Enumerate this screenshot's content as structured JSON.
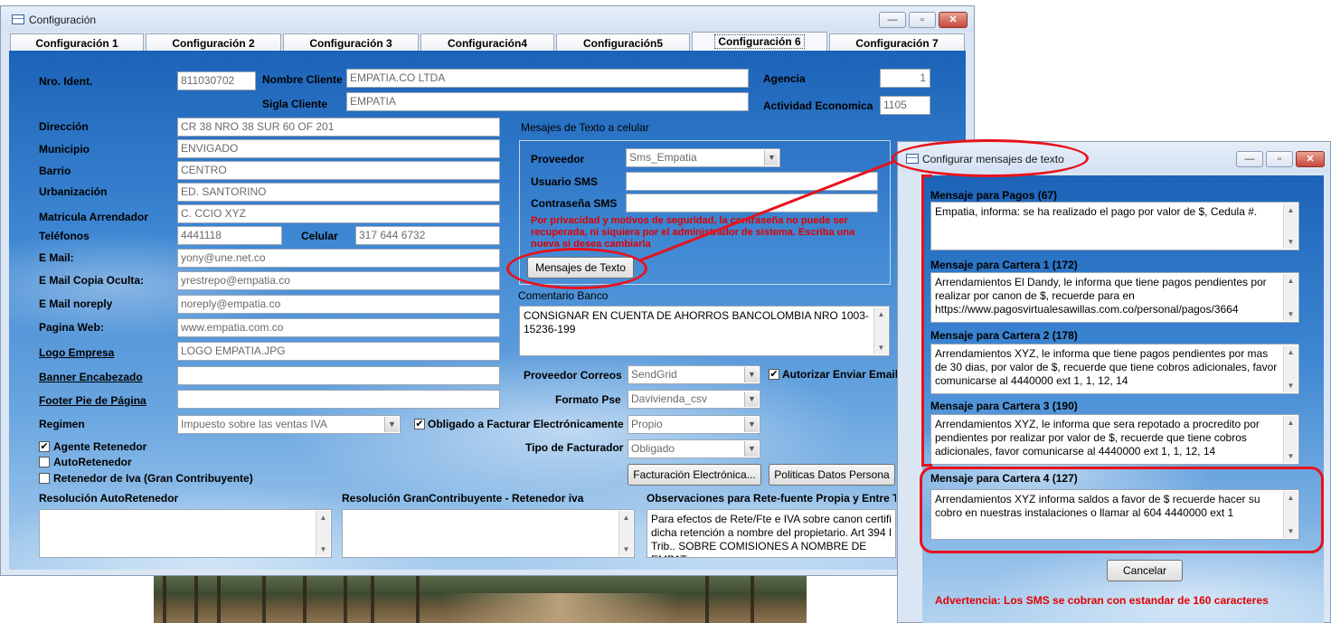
{
  "main_window": {
    "title": "Configuración",
    "tabs": [
      "Configuración 1",
      "Configuración 2",
      "Configuración 3",
      "Configuración4",
      "Configuración5",
      "Configuración 6",
      "Configuración 7"
    ],
    "active_tab": "Configuración 6"
  },
  "form": {
    "nro_ident": {
      "label": "Nro. Ident.",
      "value": "811030702"
    },
    "nombre_cliente": {
      "label": "Nombre Cliente",
      "value": "EMPATIA.CO LTDA"
    },
    "sigla_cliente": {
      "label": "Sigla Cliente",
      "value": "EMPATIA"
    },
    "agencia": {
      "label": "Agencia",
      "value": "1"
    },
    "actividad": {
      "label": "Actividad Economica",
      "value": "1105"
    },
    "direccion": {
      "label": "Dirección",
      "value": "CR 38 NRO 38 SUR 60 OF 201"
    },
    "municipio": {
      "label": "Municipio",
      "value": "ENVIGADO"
    },
    "barrio": {
      "label": "Barrio",
      "value": "CENTRO"
    },
    "urbanizacion": {
      "label": "Urbanización",
      "value": "ED. SANTORINO"
    },
    "matricula": {
      "label": "Matricula Arrendador",
      "value": "C. CCIO XYZ"
    },
    "telefonos": {
      "label": "Teléfonos",
      "value": "4441118"
    },
    "celular": {
      "label": "Celular",
      "value": "317 644 6732"
    },
    "email": {
      "label": "E Mail:",
      "value": "yony@une.net.co"
    },
    "email_oculta": {
      "label": "E Mail Copia Oculta:",
      "value": "yrestrepo@empatia.co"
    },
    "email_noreply": {
      "label": "E Mail noreply",
      "value": "noreply@empatia.co"
    },
    "pagina_web": {
      "label": "Pagina Web:",
      "value": "www.empatia.com.co"
    },
    "logo": {
      "label": "Logo Empresa",
      "value": "LOGO EMPATIA.JPG"
    },
    "banner": {
      "label": "Banner Encabezado",
      "value": ""
    },
    "footer": {
      "label": "Footer Pie de Página",
      "value": ""
    },
    "regimen": {
      "label": "Regimen",
      "value": "Impuesto sobre las ventas IVA"
    },
    "obligado_facturar": {
      "label": "Obligado a Facturar Electrónicamente",
      "checked": true,
      "value": "Propio"
    },
    "tipo_facturador": {
      "label": "Tipo de Facturador",
      "value": "Obligado"
    },
    "agente_retenedor": {
      "label": "Agente Retenedor",
      "checked": true
    },
    "autoretenedor": {
      "label": "AutoRetenedor",
      "checked": false
    },
    "retenedor_iva": {
      "label": "Retenedor de Iva (Gran Contribuyente)",
      "checked": false
    },
    "resolucion_auto": {
      "label": "Resolución AutoRetenedor",
      "value": ""
    },
    "resolucion_gran": {
      "label": "Resolución GranContribuyente  - Retenedor iva",
      "value": ""
    },
    "observaciones": {
      "label": "Observaciones para Rete-fuente Propia y Entre Te",
      "value": "Para efectos de Rete/Fte e IVA sobre canon certifi dicha retención a nombre del propietario. Art 394 I Trib.. SOBRE COMISIONES A NOMBRE DE EMPAT"
    }
  },
  "sms": {
    "section_title": "Mesajes de Texto a celular",
    "proveedor": {
      "label": "Proveedor",
      "value": "Sms_Empatia"
    },
    "usuario": {
      "label": "Usuario SMS",
      "value": ""
    },
    "contrasena": {
      "label": "Contraseña SMS",
      "value": ""
    },
    "warning": "Por privacidad y motivos de seguridad, la contraseña no puede ser recuperada, ni siquiera por el administrador de sistema. Escriba una nueva si desea cambiarla",
    "button": "Mensajes de Texto"
  },
  "comentario": {
    "label": "Comentario Banco",
    "value": "CONSIGNAR EN CUENTA DE AHORROS BANCOLOMBIA NRO 1003-15236-199"
  },
  "correos": {
    "label": "Proveedor Correos",
    "value": "SendGrid",
    "autorizar_label": "Autorizar Enviar Email",
    "autorizar_checked": true
  },
  "formato_pse": {
    "label": "Formato Pse",
    "value": "Davivienda_csv"
  },
  "buttons": {
    "facturacion": "Facturación Electrónica...",
    "politicas": "Politicas Datos Persona"
  },
  "dialog": {
    "title": "Configurar mensajes de texto",
    "messages": [
      {
        "label": "Mensaje para Pagos (67)",
        "text": "Empatia, informa: se ha realizado el pago por valor de $, Cedula #."
      },
      {
        "label": "Mensaje para Cartera 1 (172)",
        "text": "Arrendamientos El Dandy, le informa que tiene pagos pendientes por realizar por canon de $, recuerde para en https://www.pagosvirtualesawillas.com.co/personal/pagos/3664"
      },
      {
        "label": "Mensaje para Cartera 2 (178)",
        "text": "Arrendamientos XYZ, le informa que tiene pagos pendientes por mas de 30 dias, por valor de $, recuerde que tiene cobros adicionales, favor comunicarse al 4440000 ext 1, 1, 12, 14"
      },
      {
        "label": "Mensaje para Cartera 3 (190)",
        "text": "Arrendamientos XYZ, le informa que sera repotado a procredito por pendientes por realizar por valor de $, recuerde que tiene cobros adicionales, favor comunicarse al 4440000 ext 1, 1, 12, 14"
      },
      {
        "label": "Mensaje para Cartera 4 (127)",
        "text": "Arrendamientos XYZ informa saldos a favor de $ recuerde hacer su cobro en nuestras instalaciones o llamar al 604 4440000  ext 1"
      }
    ],
    "cancel": "Cancelar",
    "warning": "Advertencia: Los SMS se cobran con estandar de 160 caracteres"
  },
  "colors": {
    "annotation": "#e8121c",
    "warning_text": "#e00000"
  }
}
